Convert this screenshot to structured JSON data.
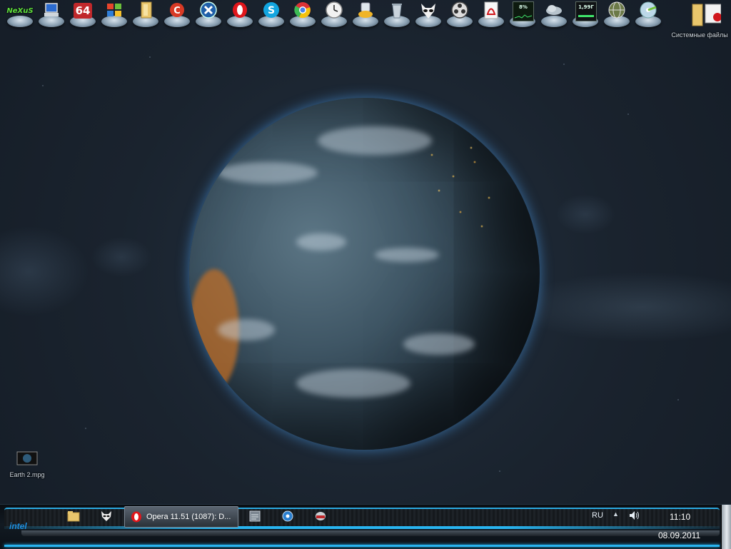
{
  "dock": {
    "items": [
      {
        "name": "nexus-icon",
        "text": "NeXuS"
      },
      {
        "name": "computer-icon",
        "text": ""
      },
      {
        "name": "aida64-icon",
        "text": "64"
      },
      {
        "name": "windows-icon",
        "text": ""
      },
      {
        "name": "folder-icon",
        "text": ""
      },
      {
        "name": "ccleaner-icon",
        "text": ""
      },
      {
        "name": "x-app-icon",
        "text": ""
      },
      {
        "name": "opera-icon",
        "text": ""
      },
      {
        "name": "skype-icon",
        "text": ""
      },
      {
        "name": "chrome-icon",
        "text": ""
      },
      {
        "name": "clock-icon",
        "text": ""
      },
      {
        "name": "utility-icon",
        "text": ""
      },
      {
        "name": "recycle-bin-icon",
        "text": ""
      },
      {
        "name": "alien-icon",
        "text": ""
      },
      {
        "name": "film-reel-icon",
        "text": ""
      },
      {
        "name": "pdf-icon",
        "text": ""
      },
      {
        "name": "cpu-meter-icon",
        "text": "8%"
      },
      {
        "name": "weather-icon",
        "text": ""
      },
      {
        "name": "memory-meter-icon",
        "text": "1,99Г"
      },
      {
        "name": "globe-icon",
        "text": ""
      },
      {
        "name": "disc-icon",
        "text": ""
      }
    ]
  },
  "desktop": {
    "top_right_icon_label": "Системные файлы",
    "bottom_left_icon_label": "Earth 2.mpg"
  },
  "taskbar": {
    "active_task_label": "Opera 11.51 (1087): D...",
    "language": "RU",
    "time": "11:10",
    "date": "08.09.2011",
    "intel_label": "intel",
    "tray_arrow": "▲",
    "colors": {
      "accent": "#28b4ef"
    }
  }
}
